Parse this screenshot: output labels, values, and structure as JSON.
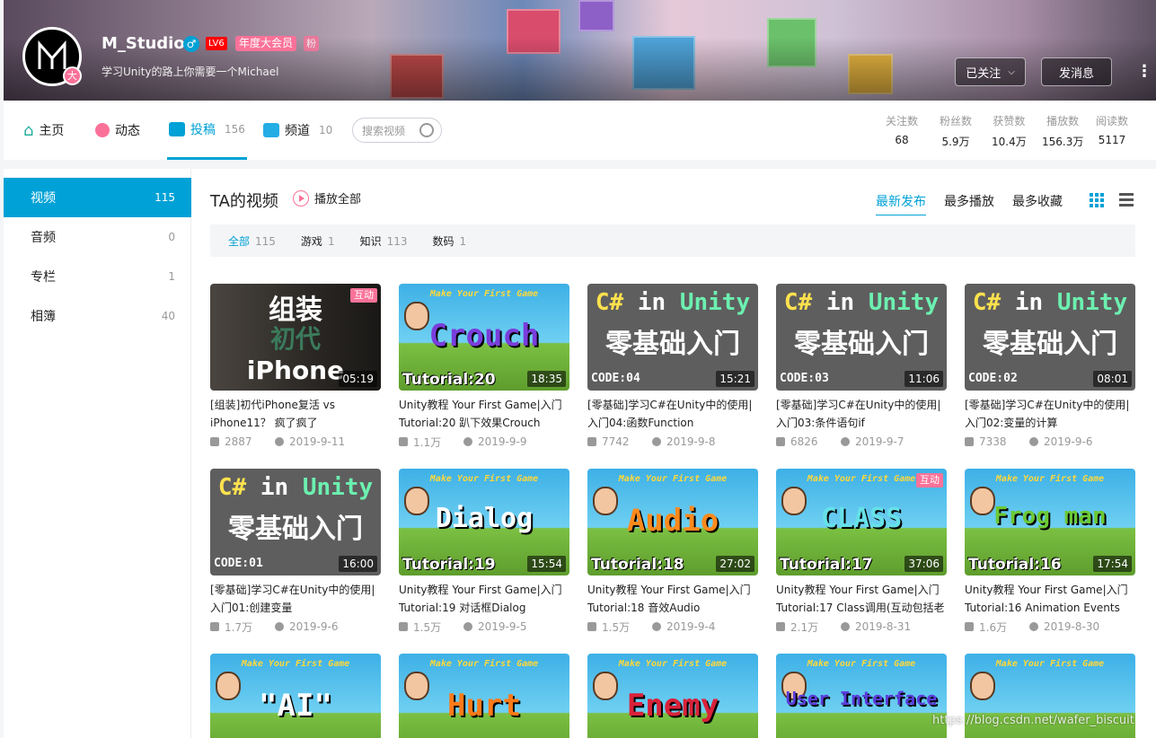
{
  "profile": {
    "name": "M_Studio",
    "gender_icon": "male-icon",
    "level": "LV6",
    "vip": "年度大会员",
    "fan_badge": "粉",
    "avatar_badge": "大",
    "sign": "学习Unity的路上你需要一个Michael",
    "follow_label": "已关注",
    "message_label": "发消息"
  },
  "nav": {
    "home": "主页",
    "dynamic": "动态",
    "contrib": "投稿",
    "contrib_count": "156",
    "channel": "频道",
    "channel_count": "10",
    "search_placeholder": "搜索视频"
  },
  "stats": [
    {
      "key": "关注数",
      "value": "68"
    },
    {
      "key": "粉丝数",
      "value": "5.9万"
    },
    {
      "key": "获赞数",
      "value": "10.4万"
    },
    {
      "key": "播放数",
      "value": "156.3万"
    },
    {
      "key": "阅读数",
      "value": "5117"
    }
  ],
  "sidebar": [
    {
      "label": "视频",
      "count": "115"
    },
    {
      "label": "音频",
      "count": "0"
    },
    {
      "label": "专栏",
      "count": "1"
    },
    {
      "label": "相簿",
      "count": "40"
    }
  ],
  "content": {
    "title": "TA的视频",
    "play_all": "播放全部",
    "sort": [
      "最新发布",
      "最多播放",
      "最多收藏"
    ],
    "filters": [
      {
        "label": "全部",
        "count": "115"
      },
      {
        "label": "游戏",
        "count": "1"
      },
      {
        "label": "知识",
        "count": "113"
      },
      {
        "label": "数码",
        "count": "1"
      }
    ]
  },
  "videos": [
    {
      "title": "[组装]初代iPhone复活 vs iPhone11？ 疯了疯了",
      "duration": "05:19",
      "views": "2887",
      "date": "2019-9-11",
      "thumb_text": "组装",
      "thumb_sub": "初代",
      "thumb_main": "iPhone",
      "tag": "互动"
    },
    {
      "title": "Unity教程 Your First Game|入门 Tutorial:20 趴下效果Crouch",
      "duration": "18:35",
      "views": "1.1万",
      "date": "2019-9-9",
      "thumb_text": "Crouch",
      "thumb_tut": "Tutorial:20",
      "header": "Make Your First Game"
    },
    {
      "title": "[零基础]学习C#在Unity中的使用|入门04:函数Function",
      "duration": "15:21",
      "views": "7742",
      "date": "2019-9-8",
      "code": "CODE:04"
    },
    {
      "title": "[零基础]学习C#在Unity中的使用|入门03:条件语句if",
      "duration": "11:06",
      "views": "6826",
      "date": "2019-9-7",
      "code": "CODE:03"
    },
    {
      "title": "[零基础]学习C#在Unity中的使用|入门02:变量的计算",
      "duration": "08:01",
      "views": "7338",
      "date": "2019-9-6",
      "code": "CODE:02"
    },
    {
      "title": "[零基础]学习C#在Unity中的使用|入门01:创建变量",
      "duration": "16:00",
      "views": "1.7万",
      "date": "2019-9-6",
      "code": "CODE:01"
    },
    {
      "title": "Unity教程 Your First Game|入门 Tutorial:19 对话框Dialog",
      "duration": "15:54",
      "views": "1.5万",
      "date": "2019-9-5",
      "thumb_text": "Dialog",
      "thumb_tut": "Tutorial:19",
      "header": "Make Your First Game"
    },
    {
      "title": "Unity教程 Your First Game|入门 Tutorial:18 音效Audio",
      "duration": "27:02",
      "views": "1.5万",
      "date": "2019-9-4",
      "thumb_text": "Audio",
      "thumb_tut": "Tutorial:18",
      "header": "Make Your First Game"
    },
    {
      "title": "Unity教程 Your First Game|入门 Tutorial:17 Class调用(互动包括老",
      "duration": "37:06",
      "views": "2.1万",
      "date": "2019-8-31",
      "thumb_text": "CLASS",
      "thumb_tut": "Tutorial:17",
      "header": "Make Your First Game",
      "tag": "互动"
    },
    {
      "title": "Unity教程 Your First Game|入门 Tutorial:16 Animation Events",
      "duration": "17:54",
      "views": "1.6万",
      "date": "2019-8-30",
      "thumb_text": "Frog man",
      "thumb_tut": "Tutorial:16",
      "header": "Make Your First Game"
    },
    {
      "thumb_text": "\"AI\"",
      "header": "Make Your First Game"
    },
    {
      "thumb_text": "Hurt",
      "header": "Make Your First Game"
    },
    {
      "thumb_text": "Enemy",
      "header": "Make Your First Game"
    },
    {
      "thumb_text": "User Interface",
      "header": "Make Your First Game"
    },
    {
      "thumb_text": "",
      "header": "Make Your First Game"
    }
  ],
  "cs_header": {
    "a": "C#",
    "b": "in",
    "c": "Unity",
    "main": "零基础入门"
  },
  "watermark": "https://blog.csdn.net/wafer_biscuit",
  "colors": {
    "accent": "#00a1d6",
    "pink": "#fb7299"
  }
}
